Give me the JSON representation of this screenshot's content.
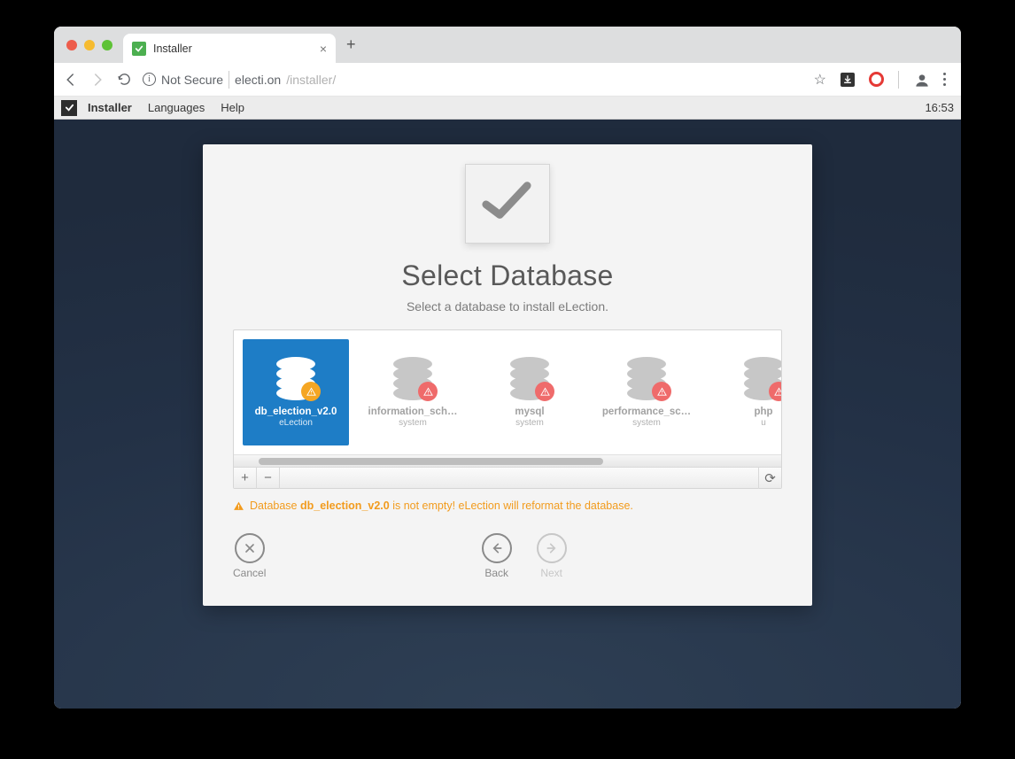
{
  "browser": {
    "tab_title": "Installer",
    "security_label": "Not Secure",
    "url_host": "electi.on",
    "url_path": "/installer/"
  },
  "menubar": {
    "items": [
      "Installer",
      "Languages",
      "Help"
    ],
    "clock": "16:53"
  },
  "page": {
    "heading": "Select Database",
    "subtitle": "Select a database to install eLection."
  },
  "databases": [
    {
      "name": "db_election_v2.0",
      "subtitle": "eLection",
      "selected": true,
      "badge": "warn-orange"
    },
    {
      "name": "information_sch…",
      "subtitle": "system",
      "selected": false,
      "badge": "warn-red"
    },
    {
      "name": "mysql",
      "subtitle": "system",
      "selected": false,
      "badge": "warn-red"
    },
    {
      "name": "performance_sc…",
      "subtitle": "system",
      "selected": false,
      "badge": "warn-red"
    },
    {
      "name": "php",
      "subtitle": "u",
      "selected": false,
      "badge": "warn-red"
    }
  ],
  "panel_buttons": {
    "add": "+",
    "remove": "−",
    "refresh": "⟳"
  },
  "warning": {
    "prefix": "Database ",
    "dbname": "db_election_v2.0",
    "suffix": " is not empty! eLection will reformat the database."
  },
  "actions": {
    "cancel": "Cancel",
    "back": "Back",
    "next": "Next"
  }
}
